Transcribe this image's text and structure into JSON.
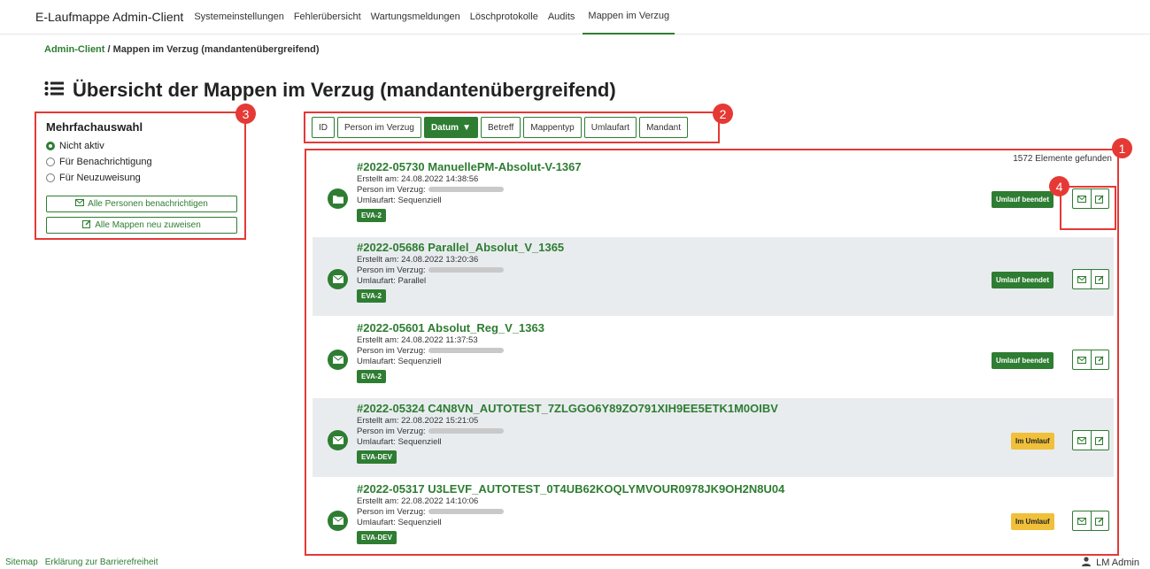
{
  "app_title": "E-Laufmappe Admin-Client",
  "nav": [
    {
      "label": "Systemeinstellungen"
    },
    {
      "label": "Fehlerübersicht"
    },
    {
      "label": "Wartungsmeldungen"
    },
    {
      "label": "Löschprotokolle"
    },
    {
      "label": "Audits"
    },
    {
      "label": "Mappen im Verzug"
    }
  ],
  "breadcrumb": {
    "root": "Admin-Client",
    "sep": "/",
    "current": "Mappen im Verzug (mandantenübergreifend)"
  },
  "page_title": "Übersicht der Mappen im Verzug (mandantenübergreifend)",
  "multi": {
    "heading": "Mehrfachauswahl",
    "options": [
      "Nicht aktiv",
      "Für Benachrichtigung",
      "Für Neuzuweisung"
    ],
    "selected": "Nicht aktiv",
    "btn_notify": "Alle Personen benachrichtigen",
    "btn_reassign": "Alle Mappen neu zuweisen"
  },
  "sort_buttons": [
    "ID",
    "Person im Verzug",
    "Datum",
    "Betreff",
    "Mappentyp",
    "Umlaufart",
    "Mandant"
  ],
  "active_sort": "Datum",
  "count_text": "1572 Elemente gefunden",
  "items": [
    {
      "title": "#2022-05730 ManuellePM-Absolut-V-1367",
      "created": "Erstellt am: 24.08.2022 14:38:56",
      "person_label": "Person im Verzug:",
      "umlauf": "Umlaufart: Sequenziell",
      "tag": "EVA-2",
      "status": "Umlauf beendet",
      "icon": "folder-icon"
    },
    {
      "title": "#2022-05686 Parallel_Absolut_V_1365",
      "created": "Erstellt am: 24.08.2022 13:20:36",
      "person_label": "Person im Verzug:",
      "umlauf": "Umlaufart: Parallel",
      "tag": "EVA-2",
      "status": "Umlauf beendet",
      "icon": "envelope-icon"
    },
    {
      "title": "#2022-05601 Absolut_Reg_V_1363",
      "created": "Erstellt am: 24.08.2022 11:37:53",
      "person_label": "Person im Verzug:",
      "umlauf": "Umlaufart: Sequenziell",
      "tag": "EVA-2",
      "status": "Umlauf beendet",
      "icon": "envelope-icon"
    },
    {
      "title": "#2022-05324 C4N8VN_AUTOTEST_7ZLGGO6Y89ZO791XIH9EE5ETK1M0OIBV",
      "created": "Erstellt am: 22.08.2022 15:21:05",
      "person_label": "Person im Verzug:",
      "umlauf": "Umlaufart: Sequenziell",
      "tag": "EVA-DEV",
      "status": "Im Umlauf",
      "icon": "envelope-icon"
    },
    {
      "title": "#2022-05317 U3LEVF_AUTOTEST_0T4UB62KOQLYMVOUR0978JK9OH2N8U04",
      "created": "Erstellt am: 22.08.2022 14:10:06",
      "person_label": "Person im Verzug:",
      "umlauf": "Umlaufart: Sequenziell",
      "tag": "EVA-DEV",
      "status": "Im Umlauf",
      "icon": "envelope-icon"
    }
  ],
  "callouts": [
    "1",
    "2",
    "3",
    "4"
  ],
  "footer": {
    "sitemap": "Sitemap",
    "a11y": "Erklärung zur Barrierefreiheit"
  },
  "user": "LM Admin",
  "colors": {
    "accent": "#2e7d32",
    "highlight": "#e53935",
    "warning": "#f0c03a"
  }
}
